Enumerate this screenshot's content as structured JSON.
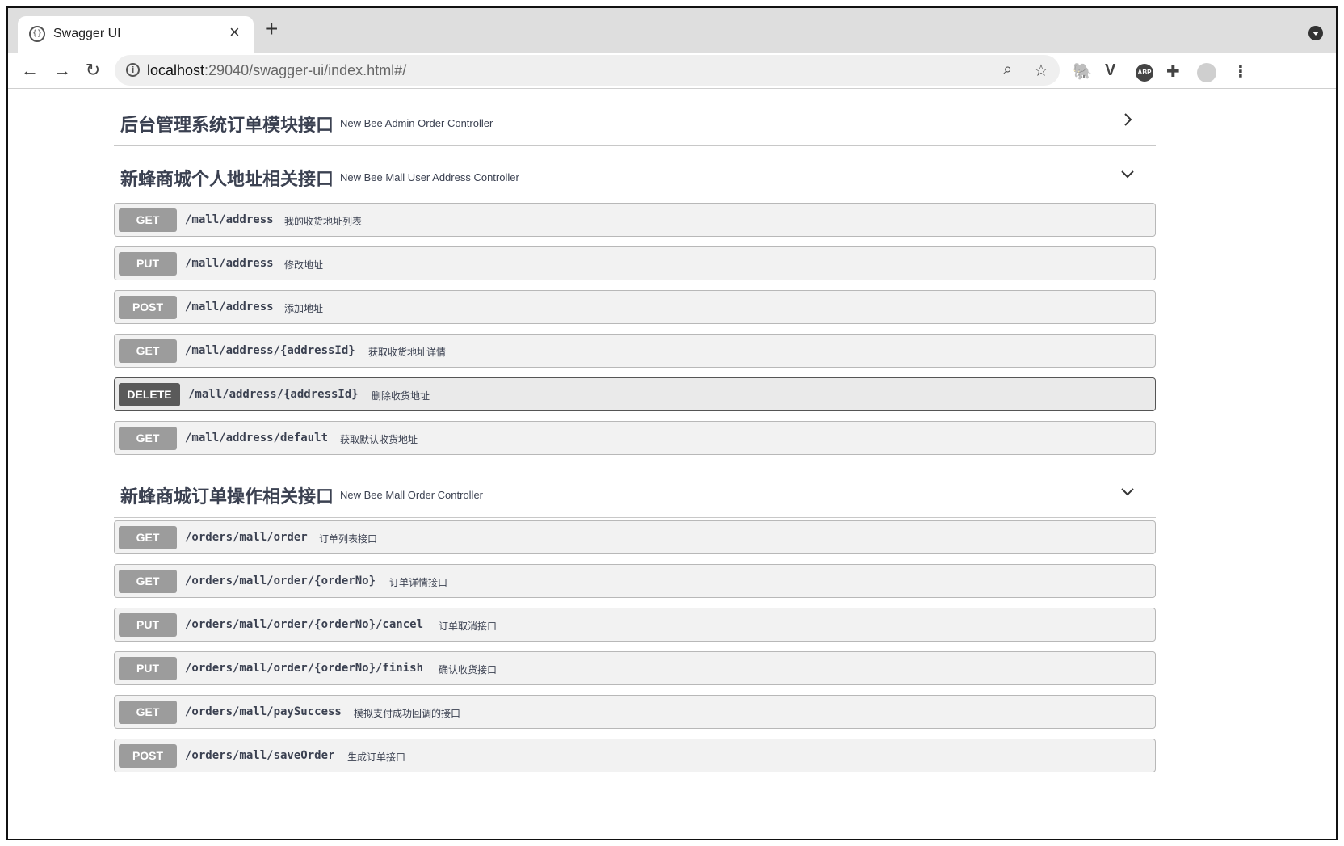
{
  "browser": {
    "tab_title": "Swagger UI",
    "tab_close": "×",
    "new_tab": "+",
    "back": "←",
    "forward": "→",
    "reload": "↻",
    "info": "i",
    "url_host": "localhost",
    "url_rest": ":29040/swagger-ui/index.html#/",
    "zoom_icon": "⌕",
    "bookmark_icon": "☆",
    "extensions": [
      "evernote-icon",
      "vivaldi-icon",
      "adblock-plus-icon",
      "puzzle-icon",
      "profile-avatar-icon",
      "menu-icon"
    ],
    "abp_label": "ABP",
    "menu_glyph": "⋮"
  },
  "sections": [
    {
      "title": "后台管理系统订单模块接口",
      "description": "New Bee Admin Order Controller",
      "expanded": false
    },
    {
      "title": "新蜂商城个人地址相关接口",
      "description": "New Bee Mall User Address Controller",
      "expanded": true,
      "operations": [
        {
          "method": "GET",
          "path": "/mall/address",
          "summary": "我的收货地址列表"
        },
        {
          "method": "PUT",
          "path": "/mall/address",
          "summary": "修改地址"
        },
        {
          "method": "POST",
          "path": "/mall/address",
          "summary": "添加地址"
        },
        {
          "method": "GET",
          "path": "/mall/address/{addressId}",
          "summary": "获取收货地址详情"
        },
        {
          "method": "DELETE",
          "path": "/mall/address/{addressId}",
          "summary": "删除收货地址"
        },
        {
          "method": "GET",
          "path": "/mall/address/default",
          "summary": "获取默认收货地址"
        }
      ]
    },
    {
      "title": "新蜂商城订单操作相关接口",
      "description": "New Bee Mall Order Controller",
      "expanded": true,
      "operations": [
        {
          "method": "GET",
          "path": "/orders/mall/order",
          "summary": "订单列表接口"
        },
        {
          "method": "GET",
          "path": "/orders/mall/order/{orderNo}",
          "summary": "订单详情接口"
        },
        {
          "method": "PUT",
          "path": "/orders/mall/order/{orderNo}/cancel",
          "summary": "订单取消接口"
        },
        {
          "method": "PUT",
          "path": "/orders/mall/order/{orderNo}/finish",
          "summary": "确认收货接口"
        },
        {
          "method": "GET",
          "path": "/orders/mall/paySuccess",
          "summary": "模拟支付成功回调的接口"
        },
        {
          "method": "POST",
          "path": "/orders/mall/saveOrder",
          "summary": "生成订单接口"
        }
      ]
    }
  ]
}
